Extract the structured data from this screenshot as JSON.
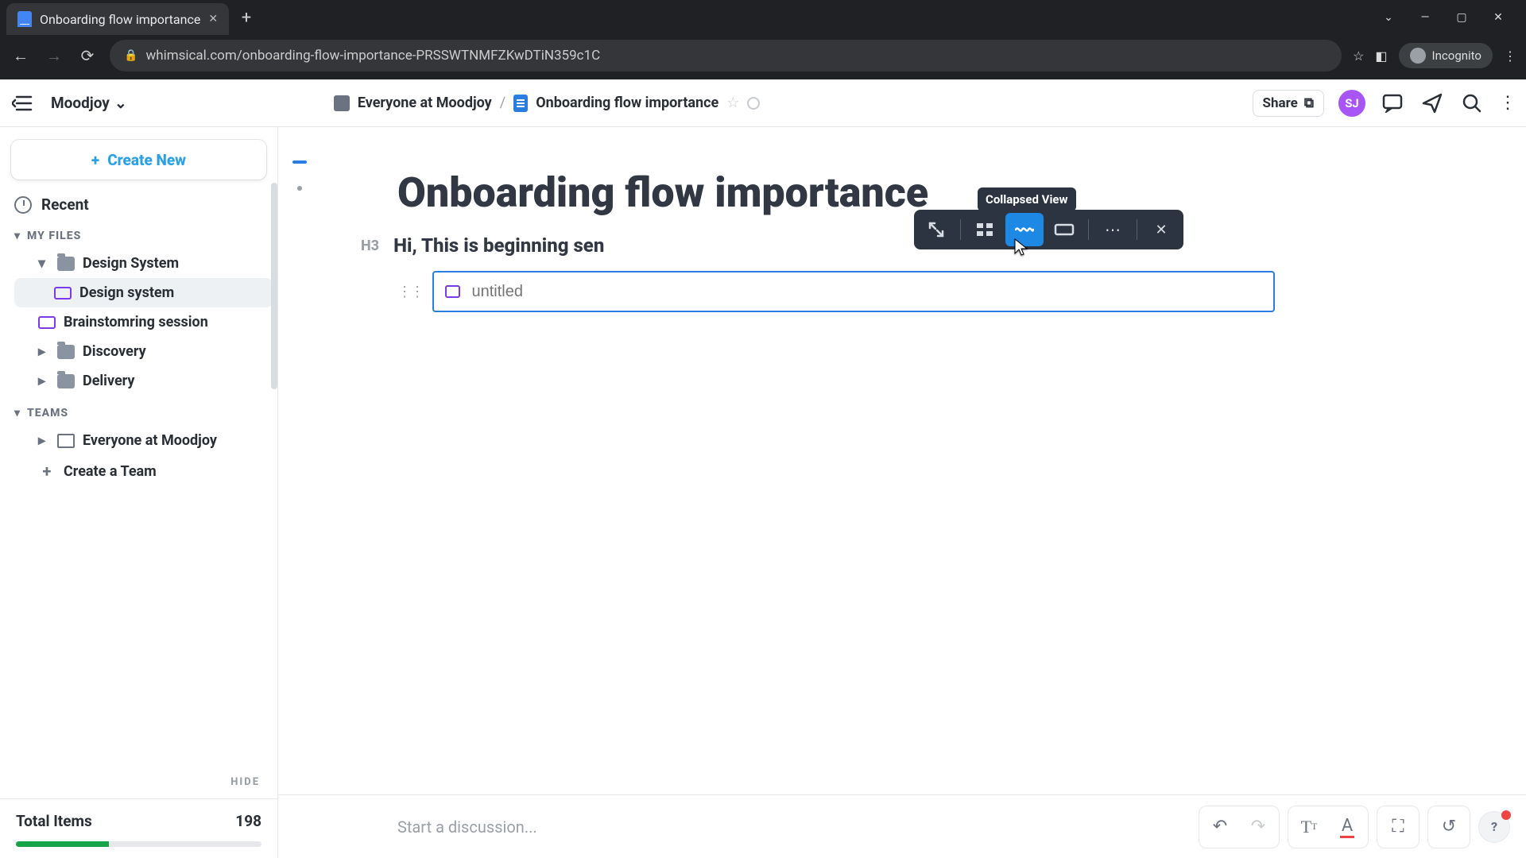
{
  "browser": {
    "tab_title": "Onboarding flow importance",
    "url_display": "whimsical.com/onboarding-flow-importance-PRSSWTNMFZKwDTiN359c1C",
    "incognito_label": "Incognito"
  },
  "app_bar": {
    "workspace": "Moodjoy",
    "breadcrumb_root": "Everyone at Moodjoy",
    "breadcrumb_doc": "Onboarding flow importance",
    "share_label": "Share",
    "avatar_initials": "SJ"
  },
  "sidebar": {
    "create_label": "Create New",
    "recent_label": "Recent",
    "my_files_label": "MY FILES",
    "teams_label": "TEAMS",
    "hide_label": "HIDE",
    "items": {
      "design_system_folder": "Design System",
      "design_system_board": "Design system",
      "brainstorm_board": "Brainstomring session",
      "discovery_folder": "Discovery",
      "delivery_folder": "Delivery",
      "team_everyone": "Everyone at Moodjoy",
      "create_team": "Create a Team"
    },
    "total_label": "Total Items",
    "total_value": "198"
  },
  "doc": {
    "title": "Onboarding flow importance",
    "h3_marker": "H3",
    "h3_text": "Hi, This is beginning sen",
    "embed_placeholder": "untitled"
  },
  "float_toolbar": {
    "tooltip": "Collapsed View"
  },
  "bottom": {
    "discussion_placeholder": "Start a discussion...",
    "help_label": "?"
  }
}
